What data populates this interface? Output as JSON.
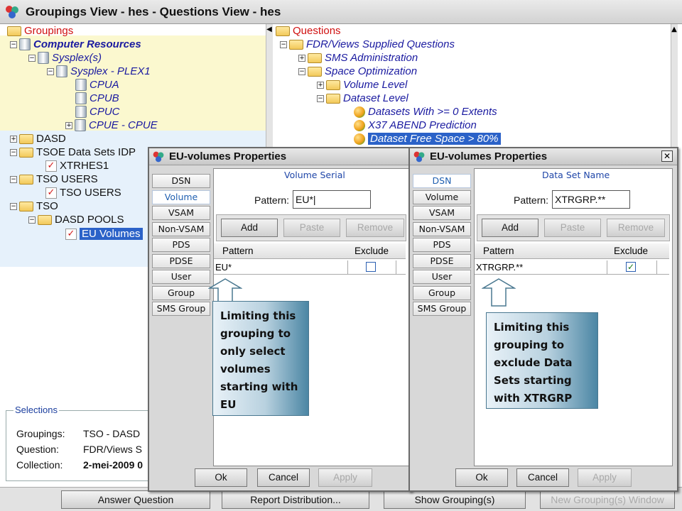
{
  "window": {
    "title": "Groupings View - hes  -  Questions View - hes"
  },
  "groupings_tree": {
    "root": "Groupings",
    "nodes": [
      {
        "label": "Computer Resources"
      },
      {
        "label": "Sysplex(s)"
      },
      {
        "label": "Sysplex - PLEX1"
      },
      {
        "label": "CPUA"
      },
      {
        "label": "CPUB"
      },
      {
        "label": "CPUC"
      },
      {
        "label": "CPUE - CPUE"
      },
      {
        "label": "DASD"
      },
      {
        "label": "TSOE Data Sets IDP"
      },
      {
        "label": "XTRHES1"
      },
      {
        "label": "TSO USERS"
      },
      {
        "label": "TSO USERS"
      },
      {
        "label": "TSO"
      },
      {
        "label": "DASD POOLS"
      },
      {
        "label": "EU Volumes"
      }
    ]
  },
  "questions_tree": {
    "root": "Questions",
    "nodes": [
      {
        "label": "FDR/Views Supplied Questions"
      },
      {
        "label": "SMS Administration"
      },
      {
        "label": "Space Optimization"
      },
      {
        "label": "Volume Level"
      },
      {
        "label": "Dataset Level"
      },
      {
        "label": "Datasets With >= 0 Extents"
      },
      {
        "label": "X37 ABEND Prediction"
      },
      {
        "label": "Dataset Free Space > 80%"
      }
    ]
  },
  "selections": {
    "legend": "Selections",
    "rows": [
      {
        "key": "Groupings:",
        "value": "TSO - DASD"
      },
      {
        "key": "Question:",
        "value": "FDR/Views S"
      },
      {
        "key": "Collection:",
        "value": "2-mei-2009 0"
      }
    ]
  },
  "bottom_buttons": [
    {
      "label": "Answer Question"
    },
    {
      "label": "Report Distribution..."
    },
    {
      "label": "Show Grouping(s)"
    },
    {
      "label": "New Grouping(s) Window"
    }
  ],
  "dialogs": [
    {
      "title": "EU-volumes Properties",
      "tabs": [
        "DSN",
        "Volume",
        "VSAM",
        "Non-VSAM",
        "PDS",
        "PDSE",
        "User",
        "Group",
        "SMS Group"
      ],
      "active_tab": "Volume",
      "group_label": "Volume Serial",
      "pattern_label": "Pattern:",
      "pattern_value": "EU*|",
      "buttons": [
        "Add",
        "Paste",
        "Remove"
      ],
      "columns": [
        "Pattern",
        "Exclude"
      ],
      "rows": [
        {
          "pattern": "EU*",
          "exclude": false
        }
      ],
      "footer": [
        "Ok",
        "Cancel",
        "Apply"
      ]
    },
    {
      "title": "EU-volumes Properties",
      "tabs": [
        "DSN",
        "Volume",
        "VSAM",
        "Non-VSAM",
        "PDS",
        "PDSE",
        "User",
        "Group",
        "SMS Group"
      ],
      "active_tab": "DSN",
      "group_label": "Data Set Name",
      "pattern_label": "Pattern:",
      "pattern_value": "XTRGRP.**",
      "buttons": [
        "Add",
        "Paste",
        "Remove"
      ],
      "columns": [
        "Pattern",
        "Exclude"
      ],
      "rows": [
        {
          "pattern": "XTRGRP.**",
          "exclude": true
        }
      ],
      "footer": [
        "Ok",
        "Cancel",
        "Apply"
      ]
    }
  ],
  "callouts": [
    {
      "text": "Limiting this grouping to only select volumes starting with EU"
    },
    {
      "text": "Limiting this grouping to exclude Data Sets starting with XTRGRP"
    }
  ],
  "colors": {
    "selection_blue": "#2b62c8",
    "tree_blue": "#1a1aa0",
    "root_red": "#d01010",
    "callout_teal": "#4b86a4"
  }
}
